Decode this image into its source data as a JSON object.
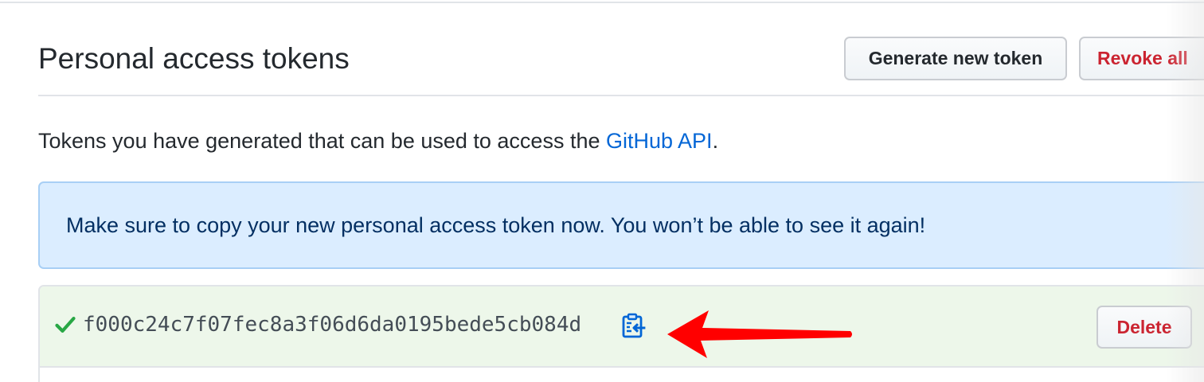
{
  "header": {
    "title": "Personal access tokens",
    "generate_label": "Generate new token",
    "revoke_label": "Revoke all"
  },
  "description": {
    "prefix": "Tokens you have generated that can be used to access the ",
    "link_text": "GitHub API",
    "suffix": "."
  },
  "flash": {
    "message": "Make sure to copy your new personal access token now. You won’t be able to see it again!"
  },
  "token": {
    "value": "f000c24c7f07fec8a3f06d6da0195bede5cb084d",
    "delete_label": "Delete",
    "status_icon": "check-icon",
    "copy_icon": "clipboard-copy-icon"
  },
  "colors": {
    "link": "#0366d6",
    "danger": "#cb2431",
    "flash_bg": "#dbedff",
    "token_row_bg": "#edf7ea",
    "check": "#28a745",
    "annotation_arrow": "#ff0000"
  }
}
